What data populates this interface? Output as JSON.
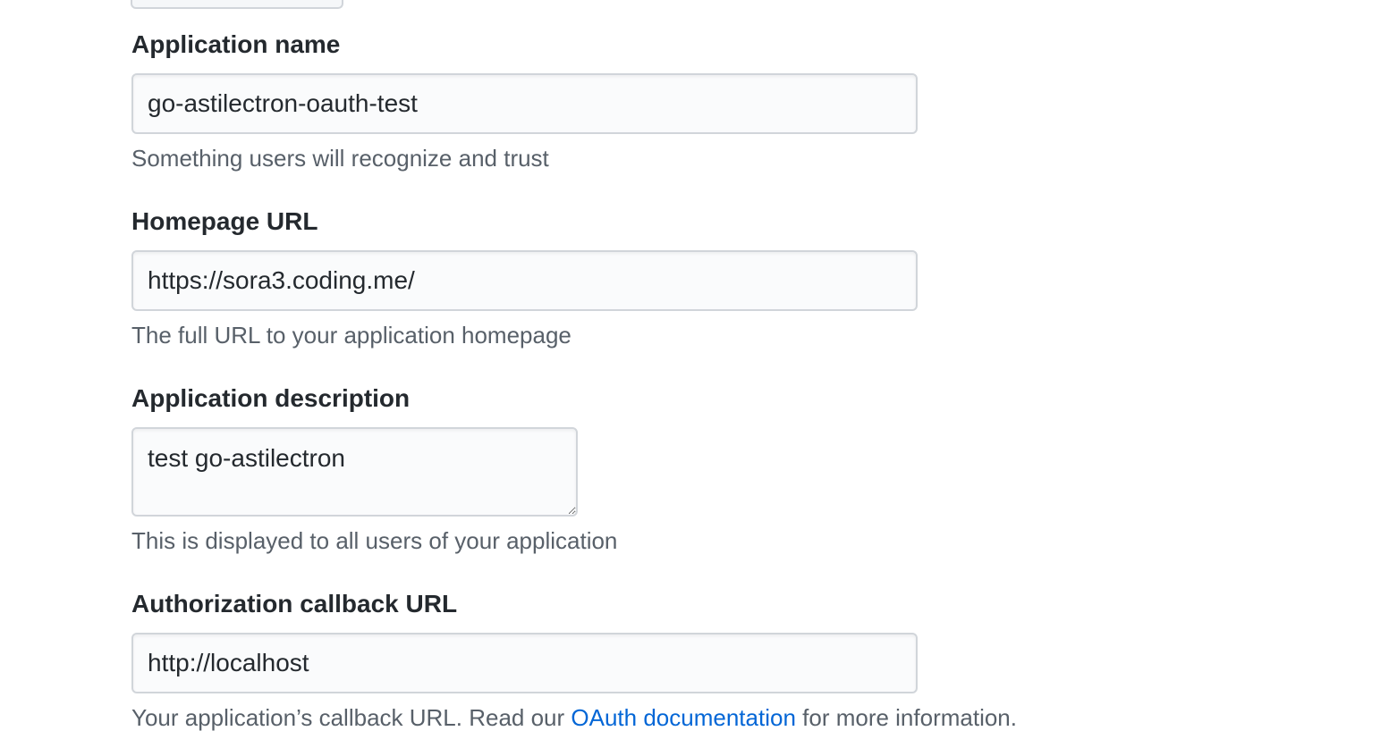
{
  "form": {
    "app_name": {
      "label": "Application name",
      "value": "go-astilectron-oauth-test",
      "note": "Something users will recognize and trust"
    },
    "homepage": {
      "label": "Homepage URL",
      "value": "https://sora3.coding.me/",
      "note": "The full URL to your application homepage"
    },
    "description": {
      "label": "Application description",
      "value": "test go-astilectron",
      "note": "This is displayed to all users of your application"
    },
    "callback": {
      "label": "Authorization callback URL",
      "value": "http://localhost",
      "note_prefix": "Your application’s callback URL. Read our ",
      "note_link": "OAuth documentation",
      "note_suffix": " for more information."
    }
  },
  "colors": {
    "label": "#24292e",
    "note": "#586069",
    "link": "#0366d6",
    "input_border": "#d1d5da",
    "input_bg": "#fafbfc"
  }
}
